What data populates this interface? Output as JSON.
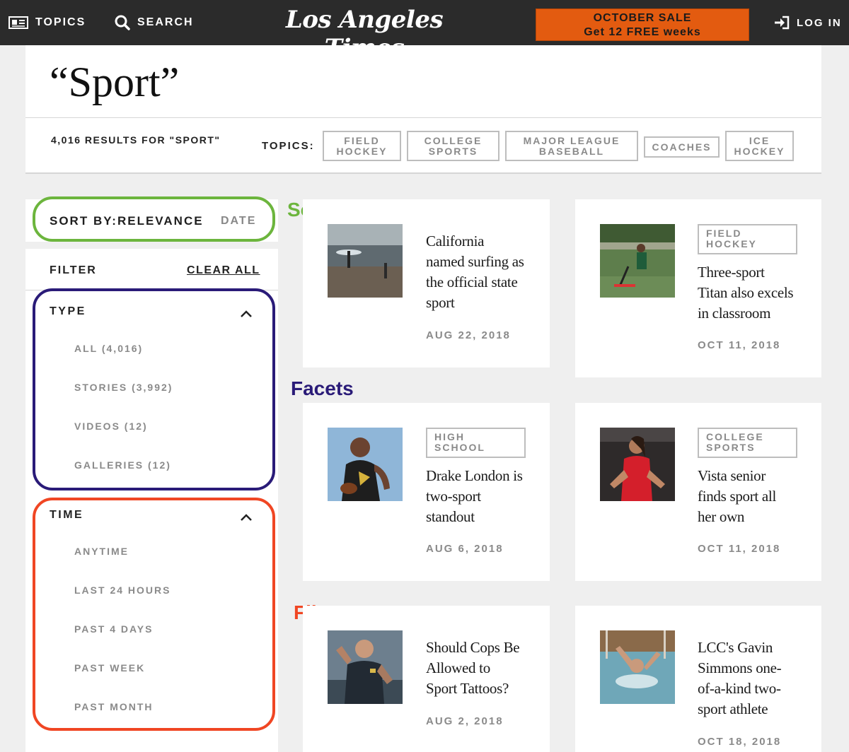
{
  "nav": {
    "topics_label": "TOPICS",
    "search_label": "SEARCH",
    "logo_text": "Los Angeles Times",
    "sale_line1": "OCTOBER SALE",
    "sale_line2": "Get 12 FREE weeks",
    "login_label": "LOG IN"
  },
  "header": {
    "title": "“Sport”",
    "results": "4,016 RESULTS FOR \"SPORT\"",
    "topics_label": "TOPICS:",
    "topics": [
      {
        "line1": "FIELD",
        "line2": "HOCKEY"
      },
      {
        "line1": "COLLEGE",
        "line2": "SPORTS"
      },
      {
        "line1": "MAJOR LEAGUE",
        "line2": "BASEBALL"
      },
      {
        "line1": "COACHES",
        "line2": ""
      },
      {
        "line1": "ICE",
        "line2": "HOCKEY"
      }
    ]
  },
  "sort": {
    "label": "SORT BY:",
    "active": "RELEVANCE",
    "other": "DATE"
  },
  "filter": {
    "title": "FILTER",
    "clear_label": "CLEAR ALL",
    "type": {
      "title": "TYPE",
      "options": [
        "ALL (4,016)",
        "STORIES (3,992)",
        "VIDEOS (12)",
        "GALLERIES (12)"
      ]
    },
    "time": {
      "title": "TIME",
      "options": [
        "ANYTIME",
        "LAST 24 HOURS",
        "PAST 4 DAYS",
        "PAST WEEK",
        "PAST MONTH"
      ]
    }
  },
  "annotations": {
    "sort": {
      "label": "Sort",
      "color": "#6cb53d"
    },
    "facets": {
      "label": "Facets",
      "color": "#2a1b78"
    },
    "filters": {
      "label": "Filters",
      "color": "#f04623"
    }
  },
  "cards": [
    {
      "title_lines": [
        "California",
        "named surfing as",
        "the official state",
        "sport"
      ],
      "date": "AUG 22, 2018",
      "tag": ""
    },
    {
      "title_lines": [
        "Three-sport",
        "Titan also excels",
        "in classroom"
      ],
      "date": "OCT 11, 2018",
      "tag_lines": [
        "FIELD",
        "HOCKEY"
      ]
    },
    {
      "title_lines": [
        "Drake London is",
        "two-sport",
        "standout"
      ],
      "date": "AUG 6, 2018",
      "tag_lines": [
        "HIGH",
        "SCHOOL"
      ]
    },
    {
      "title_lines": [
        "Vista senior",
        "finds sport all",
        "her own"
      ],
      "date": "OCT 11, 2018",
      "tag_lines": [
        "COLLEGE",
        "SPORTS"
      ]
    },
    {
      "title_lines": [
        "Should Cops Be",
        "Allowed to",
        "Sport Tattoos?"
      ],
      "date": "AUG 2, 2018",
      "tag": ""
    },
    {
      "title_lines": [
        "LCC's Gavin",
        "Simmons one-",
        "of-a-kind two-",
        "sport athlete"
      ],
      "date": "OCT 18, 2018",
      "tag": ""
    }
  ]
}
